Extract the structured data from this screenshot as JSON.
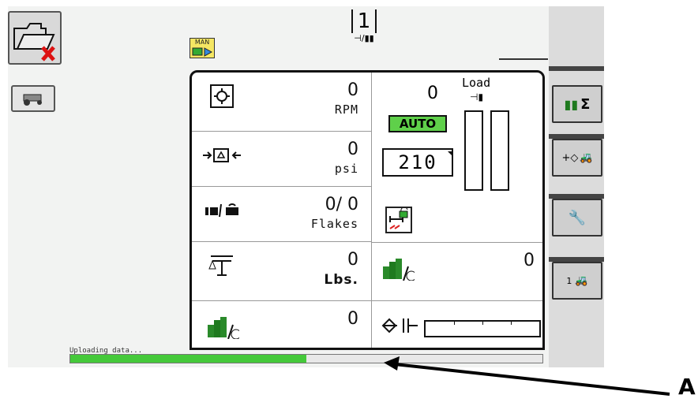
{
  "top": {
    "mode_badge": "MAN",
    "counter": "1",
    "counter_caption": "⊣/▮▮"
  },
  "left": {
    "folder_icon": "folder-delete-icon",
    "machine_icon": "tractor-icon"
  },
  "right": {
    "buttons": [
      {
        "label": "Σ"
      },
      {
        "label": "+◇"
      },
      {
        "label": "🔧"
      },
      {
        "label": "1"
      }
    ]
  },
  "panel": {
    "rpm_value": "0",
    "rpm_unit": "RPM",
    "psi_value": "0",
    "psi_unit": "psi",
    "flakes_value": "0/ 0",
    "flakes_unit": "Flakes",
    "weight_value": "0",
    "weight_unit": "Lbs.",
    "rate_value": "0",
    "bottom_value": "0",
    "load_value": "0",
    "load_label": "Load",
    "auto_label": "AUTO",
    "setpoint": "210"
  },
  "status": {
    "text": "Uploading data...",
    "progress": 0.5
  },
  "annotation": {
    "label": "A"
  },
  "colors": {
    "accent_green": "#45c93a",
    "auto_bg": "#5fd04a",
    "man_bg": "#f5e663"
  }
}
